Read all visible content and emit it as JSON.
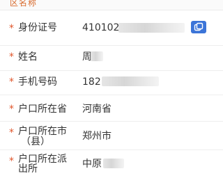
{
  "section": {
    "title": "区名称"
  },
  "form": {
    "required_mark": "*",
    "rows": [
      {
        "label": "身份证号",
        "value": "410102",
        "masked": true
      },
      {
        "label": "姓名",
        "value": "周",
        "masked": true
      },
      {
        "label": "手机号码",
        "value": "182",
        "masked": true
      },
      {
        "label": "户口所在省",
        "value": "河南省",
        "masked": false
      },
      {
        "label_line1": "户口所在市",
        "label_line2": "（县）",
        "value": "郑州市",
        "masked": false
      },
      {
        "label_line1": "户口所在派",
        "label_line2": "出所",
        "value": "中原",
        "masked": true
      }
    ]
  },
  "icons": {
    "copy": "copy-icon"
  },
  "colors": {
    "required": "#e0552a",
    "accent": "#3b74d8",
    "section_title": "#d86a2c"
  }
}
